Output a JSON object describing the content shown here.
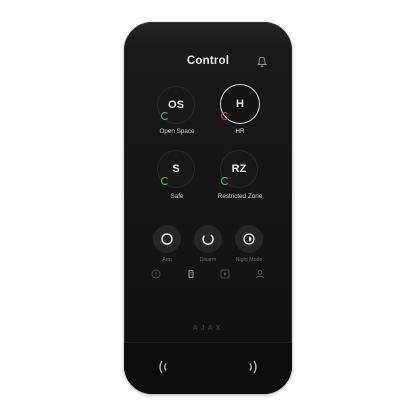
{
  "header": {
    "title": "Control",
    "bell_icon": "bell-icon"
  },
  "groups": [
    {
      "abbr": "OS",
      "label": "Open Space",
      "status_color": "#3cc47c",
      "active": false
    },
    {
      "abbr": "H",
      "label": "HR",
      "status_color": "#e03c3c",
      "active": true
    },
    {
      "abbr": "S",
      "label": "Safe",
      "status_color": "#3cc47c",
      "active": false
    },
    {
      "abbr": "RZ",
      "label": "Restricted Zone",
      "status_color": "#3cc47c",
      "active": false
    }
  ],
  "modes": [
    {
      "label": "Arm",
      "icon": "arm-ring-icon"
    },
    {
      "label": "Disarm",
      "icon": "disarm-ring-icon"
    },
    {
      "label": "Night Mode",
      "icon": "night-mode-icon"
    }
  ],
  "nav": [
    {
      "icon": "alert-icon"
    },
    {
      "icon": "keypad-icon",
      "active": true
    },
    {
      "icon": "play-icon"
    },
    {
      "icon": "user-icon"
    }
  ],
  "brand": "AJAX",
  "nfc": {
    "left_icon": "nfc-waves-left-icon",
    "right_icon": "nfc-waves-right-icon"
  }
}
